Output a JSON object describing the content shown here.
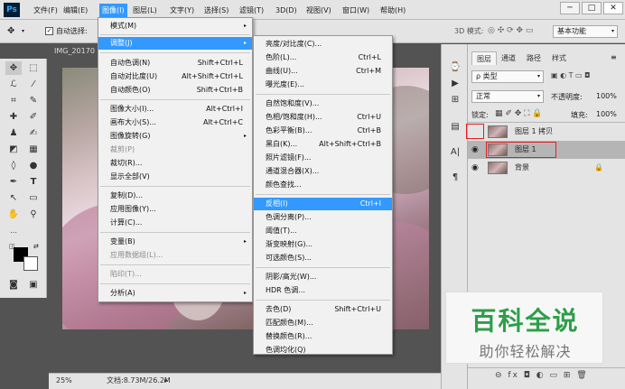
{
  "app": {
    "logo": "Ps"
  },
  "menubar": {
    "items": [
      "文件(F)",
      "编辑(E)",
      "图像(I)",
      "图层(L)",
      "文字(Y)",
      "选择(S)",
      "滤镜(T)",
      "3D(D)",
      "视图(V)",
      "窗口(W)",
      "帮助(H)"
    ]
  },
  "window_controls": {
    "minimize": "─",
    "maximize": "□",
    "close": "✕"
  },
  "options_bar": {
    "auto_select_label": "自动选择:",
    "mode3d_label": "3D 模式:",
    "workspace": "基本功能"
  },
  "document": {
    "tab_title": "IMG_20170",
    "zoom": "25%",
    "doc_info": "文档:8.73M/26.2M"
  },
  "image_menu": {
    "items": [
      {
        "label": "模式(M)",
        "sub": "▸"
      },
      {
        "label": "调整(J)",
        "sub": "▸"
      },
      {
        "label": "自动色调(N)",
        "shortcut": "Shift+Ctrl+L"
      },
      {
        "label": "自动对比度(U)",
        "shortcut": "Alt+Shift+Ctrl+L"
      },
      {
        "label": "自动颜色(O)",
        "shortcut": "Shift+Ctrl+B"
      },
      {
        "label": "图像大小(I)...",
        "shortcut": "Alt+Ctrl+I"
      },
      {
        "label": "画布大小(S)...",
        "shortcut": "Alt+Ctrl+C"
      },
      {
        "label": "图像旋转(G)",
        "sub": "▸"
      },
      {
        "label": "裁剪(P)"
      },
      {
        "label": "裁切(R)..."
      },
      {
        "label": "显示全部(V)"
      },
      {
        "label": "复制(D)..."
      },
      {
        "label": "应用图像(Y)..."
      },
      {
        "label": "计算(C)..."
      },
      {
        "label": "变量(B)",
        "sub": "▸"
      },
      {
        "label": "应用数据组(L)..."
      },
      {
        "label": "陷印(T)..."
      },
      {
        "label": "分析(A)",
        "sub": "▸"
      }
    ]
  },
  "adjust_menu": {
    "items": [
      {
        "label": "亮度/对比度(C)..."
      },
      {
        "label": "色阶(L)...",
        "shortcut": "Ctrl+L"
      },
      {
        "label": "曲线(U)...",
        "shortcut": "Ctrl+M"
      },
      {
        "label": "曝光度(E)..."
      },
      {
        "label": "自然饱和度(V)..."
      },
      {
        "label": "色相/饱和度(H)...",
        "shortcut": "Ctrl+U"
      },
      {
        "label": "色彩平衡(B)...",
        "shortcut": "Ctrl+B"
      },
      {
        "label": "黑白(K)...",
        "shortcut": "Alt+Shift+Ctrl+B"
      },
      {
        "label": "照片滤镜(F)..."
      },
      {
        "label": "通道混合器(X)..."
      },
      {
        "label": "颜色查找..."
      },
      {
        "label": "反相(I)",
        "shortcut": "Ctrl+I"
      },
      {
        "label": "色调分离(P)..."
      },
      {
        "label": "阈值(T)..."
      },
      {
        "label": "渐变映射(G)..."
      },
      {
        "label": "可选颜色(S)..."
      },
      {
        "label": "阴影/高光(W)..."
      },
      {
        "label": "HDR 色调..."
      },
      {
        "label": "去色(D)",
        "shortcut": "Shift+Ctrl+U"
      },
      {
        "label": "匹配颜色(M)..."
      },
      {
        "label": "替换颜色(R)..."
      },
      {
        "label": "色调均化(Q)"
      }
    ]
  },
  "layers_panel": {
    "tabs": [
      "图层",
      "通道",
      "路径",
      "样式"
    ],
    "filter_kind": "ρ 类型",
    "blend_mode": "正常",
    "opacity_label": "不透明度:",
    "opacity_value": "100%",
    "lock_label": "锁定:",
    "fill_label": "填充:",
    "fill_value": "100%",
    "layers": [
      {
        "name": "图层 1 拷贝",
        "visible": false
      },
      {
        "name": "图层 1",
        "visible": true
      },
      {
        "name": "背景",
        "visible": true,
        "locked": true
      }
    ],
    "footer_icons": "⊖  fx  ◘  ◐  ▭  ⊞  🗑"
  },
  "watermark": {
    "title": "百科全说",
    "subtitle": "助你轻松解决"
  },
  "colors": {
    "menu_highlight": "#3399ff",
    "red_box": "#e02020",
    "watermark_green": "#2e9e4a"
  }
}
